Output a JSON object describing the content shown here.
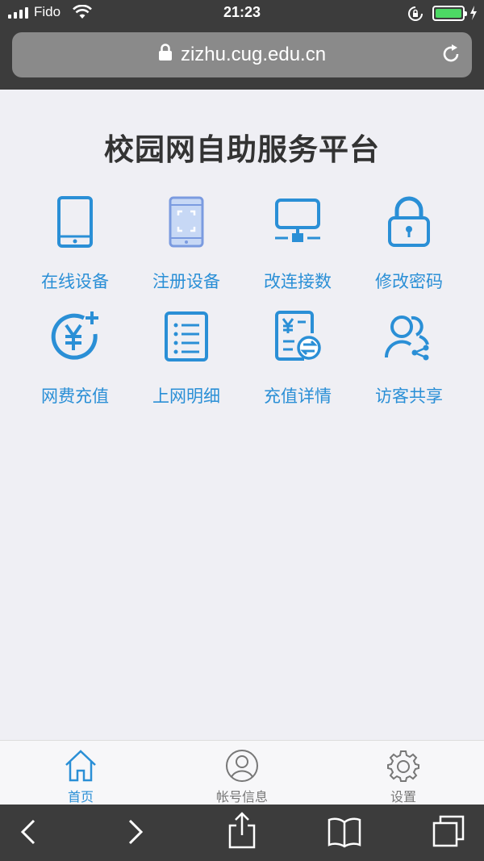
{
  "status": {
    "carrier": "Fido",
    "time": "21:23",
    "battery_color": "#4cd964"
  },
  "browser": {
    "url": "zizhu.cug.edu.cn"
  },
  "page": {
    "title": "校园网自助服务平台"
  },
  "tiles": [
    {
      "label": "在线设备",
      "icon": "phone-icon"
    },
    {
      "label": "注册设备",
      "icon": "scan-phone-icon"
    },
    {
      "label": "改连接数",
      "icon": "network-monitor-icon"
    },
    {
      "label": "修改密码",
      "icon": "padlock-icon"
    },
    {
      "label": "网费充值",
      "icon": "yuan-plus-icon"
    },
    {
      "label": "上网明细",
      "icon": "list-document-icon"
    },
    {
      "label": "充值详情",
      "icon": "bill-exchange-icon"
    },
    {
      "label": "访客共享",
      "icon": "users-share-icon"
    }
  ],
  "tabbar": [
    {
      "label": "首页",
      "icon": "home-icon",
      "active": true
    },
    {
      "label": "帐号信息",
      "icon": "user-icon",
      "active": false
    },
    {
      "label": "设置",
      "icon": "gear-icon",
      "active": false
    }
  ],
  "colors": {
    "accent": "#2a8fd6",
    "background": "#efeff4",
    "chrome": "#3c3c3c"
  }
}
